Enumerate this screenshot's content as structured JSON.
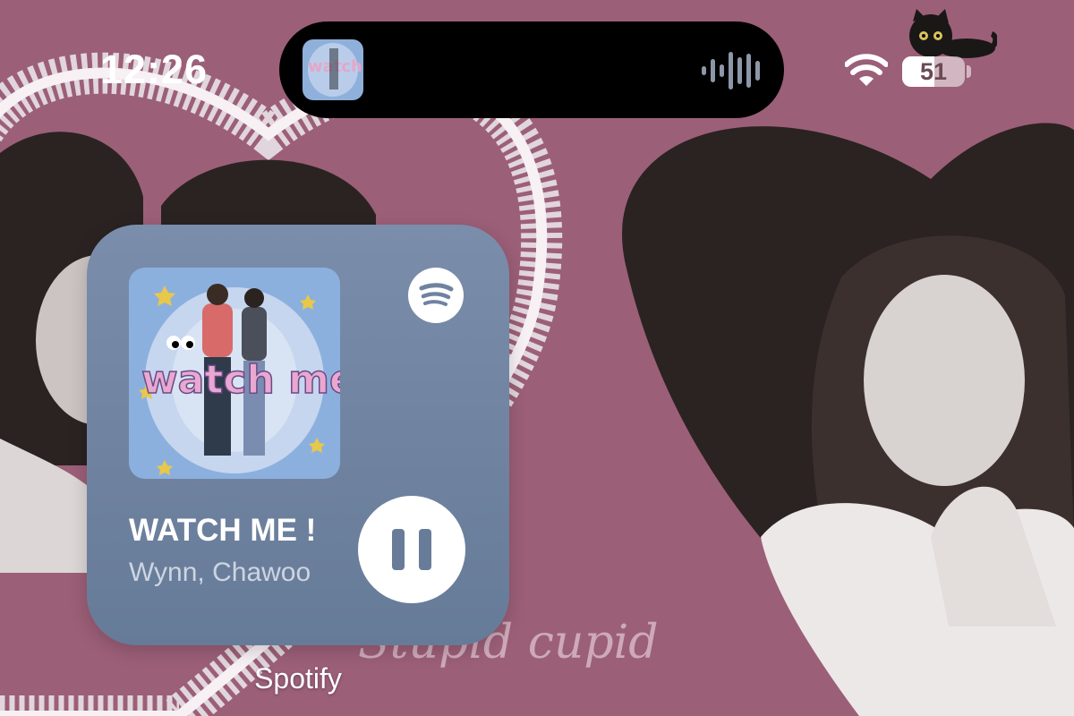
{
  "status_bar": {
    "time": "12:26",
    "battery_percent": "51",
    "battery_level": 0.51,
    "icons": [
      "wifi-icon",
      "battery-icon",
      "audio-waveform-icon",
      "black-cat-sticker-icon"
    ]
  },
  "dynamic_island": {
    "artwork_text": "watch me"
  },
  "widget": {
    "app_label": "Spotify",
    "song_title": "WATCH ME !",
    "artist": "Wynn, Chawoo",
    "album_art_text": "watch me!",
    "playback_state": "playing",
    "controls": [
      "pause-icon"
    ],
    "colors": {
      "widget_bg": "#6f83a1",
      "pause_glyph": "#687c99"
    }
  },
  "wallpaper": {
    "script_text": "Stupid cupid",
    "colors": {
      "background": "#9c5f78",
      "frame": "#e9e3e6",
      "photo": "#2a2322"
    }
  }
}
